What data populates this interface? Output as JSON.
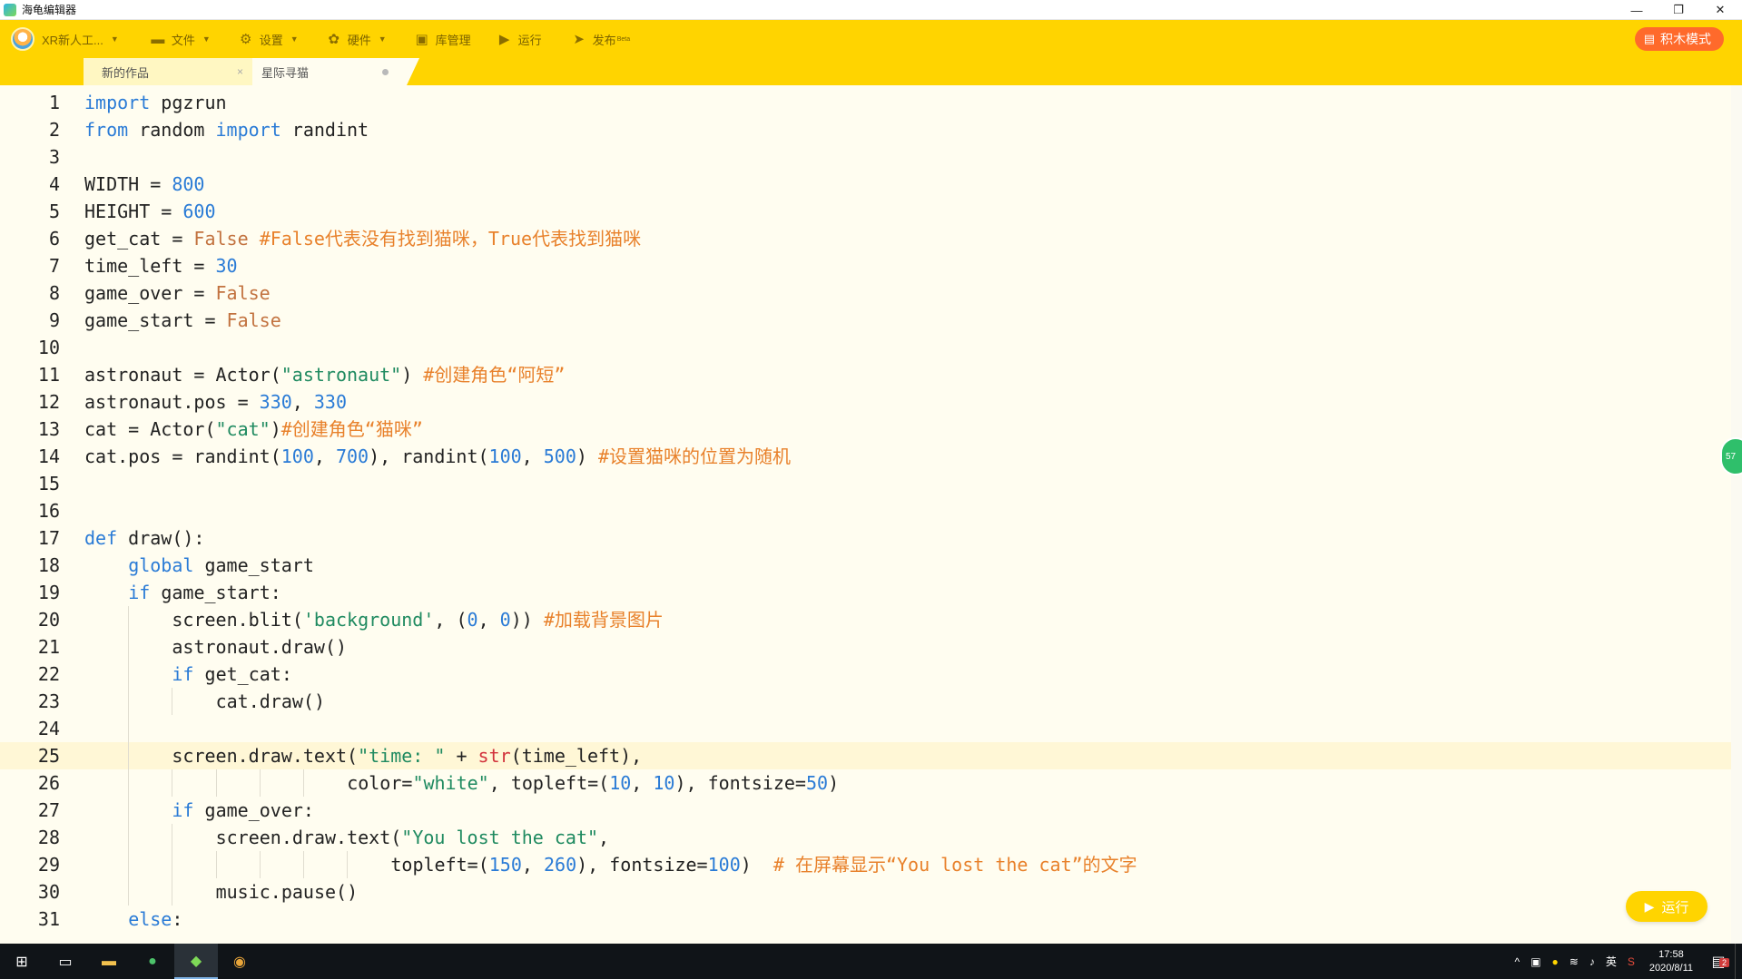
{
  "window": {
    "title": "海龟编辑器",
    "controls": {
      "minimize": "—",
      "restore": "❐",
      "close": "✕"
    }
  },
  "toolbar": {
    "user_label": "XR新人工...",
    "file_label": "文件",
    "settings_label": "设置",
    "hardware_label": "硬件",
    "library_label": "库管理",
    "run_label": "运行",
    "publish_label": "发布",
    "publish_badge": "Beta",
    "block_mode_label": "积木模式"
  },
  "tabs": [
    {
      "label": "新的作品",
      "close": "×"
    },
    {
      "label": "星际寻猫"
    }
  ],
  "editor": {
    "current_line": 25,
    "lines": [
      {
        "n": "1",
        "indent": 0,
        "tokens": [
          [
            "kw",
            "import"
          ],
          [
            "t",
            " pgzrun"
          ]
        ]
      },
      {
        "n": "2",
        "indent": 0,
        "tokens": [
          [
            "kw",
            "from"
          ],
          [
            "t",
            " random "
          ],
          [
            "kw",
            "import"
          ],
          [
            "t",
            " randint"
          ]
        ]
      },
      {
        "n": "3",
        "indent": 0,
        "tokens": []
      },
      {
        "n": "4",
        "indent": 0,
        "tokens": [
          [
            "t",
            "WIDTH = "
          ],
          [
            "num",
            "800"
          ]
        ]
      },
      {
        "n": "5",
        "indent": 0,
        "tokens": [
          [
            "t",
            "HEIGHT = "
          ],
          [
            "num",
            "600"
          ]
        ]
      },
      {
        "n": "6",
        "indent": 0,
        "tokens": [
          [
            "t",
            "get_cat = "
          ],
          [
            "bool",
            "False"
          ],
          [
            "t",
            " "
          ],
          [
            "cmt",
            "#False代表没有找到猫咪，True代表找到猫咪"
          ]
        ]
      },
      {
        "n": "7",
        "indent": 0,
        "tokens": [
          [
            "t",
            "time_left = "
          ],
          [
            "num",
            "30"
          ]
        ]
      },
      {
        "n": "8",
        "indent": 0,
        "tokens": [
          [
            "t",
            "game_over = "
          ],
          [
            "bool",
            "False"
          ]
        ]
      },
      {
        "n": "9",
        "indent": 0,
        "tokens": [
          [
            "t",
            "game_start = "
          ],
          [
            "bool",
            "False"
          ]
        ]
      },
      {
        "n": "10",
        "indent": 0,
        "tokens": []
      },
      {
        "n": "11",
        "indent": 0,
        "tokens": [
          [
            "t",
            "astronaut = Actor("
          ],
          [
            "str",
            "\"astronaut\""
          ],
          [
            "t",
            ") "
          ],
          [
            "cmt",
            "#创建角色“阿短”"
          ]
        ]
      },
      {
        "n": "12",
        "indent": 0,
        "tokens": [
          [
            "t",
            "astronaut.pos = "
          ],
          [
            "num",
            "330"
          ],
          [
            "t",
            ", "
          ],
          [
            "num",
            "330"
          ]
        ]
      },
      {
        "n": "13",
        "indent": 0,
        "tokens": [
          [
            "t",
            "cat = Actor("
          ],
          [
            "str",
            "\"cat\""
          ],
          [
            "t",
            ")"
          ],
          [
            "cmt",
            "#创建角色“猫咪”"
          ]
        ]
      },
      {
        "n": "14",
        "indent": 0,
        "tokens": [
          [
            "t",
            "cat.pos = randint("
          ],
          [
            "num",
            "100"
          ],
          [
            "t",
            ", "
          ],
          [
            "num",
            "700"
          ],
          [
            "t",
            "), randint("
          ],
          [
            "num",
            "100"
          ],
          [
            "t",
            ", "
          ],
          [
            "num",
            "500"
          ],
          [
            "t",
            ") "
          ],
          [
            "cmt",
            "#设置猫咪的位置为随机"
          ]
        ]
      },
      {
        "n": "15",
        "indent": 0,
        "tokens": []
      },
      {
        "n": "16",
        "indent": 0,
        "tokens": []
      },
      {
        "n": "17",
        "indent": 0,
        "tokens": [
          [
            "kw",
            "def"
          ],
          [
            "t",
            " draw():"
          ]
        ]
      },
      {
        "n": "18",
        "indent": 1,
        "tokens": [
          [
            "kw",
            "global"
          ],
          [
            "t",
            " game_start"
          ]
        ]
      },
      {
        "n": "19",
        "indent": 1,
        "tokens": [
          [
            "kw",
            "if"
          ],
          [
            "t",
            " game_start:"
          ]
        ]
      },
      {
        "n": "20",
        "indent": 2,
        "tokens": [
          [
            "t",
            "screen.blit("
          ],
          [
            "str",
            "'background'"
          ],
          [
            "t",
            ", ("
          ],
          [
            "num",
            "0"
          ],
          [
            "t",
            ", "
          ],
          [
            "num",
            "0"
          ],
          [
            "t",
            ")) "
          ],
          [
            "cmt",
            "#加载背景图片"
          ]
        ]
      },
      {
        "n": "21",
        "indent": 2,
        "tokens": [
          [
            "t",
            "astronaut.draw()"
          ]
        ]
      },
      {
        "n": "22",
        "indent": 2,
        "tokens": [
          [
            "kw",
            "if"
          ],
          [
            "t",
            " get_cat:"
          ]
        ]
      },
      {
        "n": "23",
        "indent": 3,
        "tokens": [
          [
            "t",
            "cat.draw()"
          ]
        ]
      },
      {
        "n": "24",
        "indent": 2,
        "tokens": []
      },
      {
        "n": "25",
        "indent": 2,
        "tokens": [
          [
            "t",
            "screen.draw.text("
          ],
          [
            "str",
            "\"time: \""
          ],
          [
            "t",
            " + "
          ],
          [
            "fn",
            "str"
          ],
          [
            "t",
            "(time_left),"
          ]
        ]
      },
      {
        "n": "26",
        "indent": 6,
        "tokens": [
          [
            "t",
            "color="
          ],
          [
            "str",
            "\"white\""
          ],
          [
            "t",
            ", topleft=("
          ],
          [
            "num",
            "10"
          ],
          [
            "t",
            ", "
          ],
          [
            "num",
            "10"
          ],
          [
            "t",
            "), fontsize="
          ],
          [
            "num",
            "50"
          ],
          [
            "t",
            ")"
          ]
        ]
      },
      {
        "n": "27",
        "indent": 2,
        "tokens": [
          [
            "kw",
            "if"
          ],
          [
            "t",
            " game_over:"
          ]
        ]
      },
      {
        "n": "28",
        "indent": 3,
        "tokens": [
          [
            "t",
            "screen.draw.text("
          ],
          [
            "str",
            "\"You lost the cat\""
          ],
          [
            "t",
            ","
          ]
        ]
      },
      {
        "n": "29",
        "indent": 7,
        "tokens": [
          [
            "t",
            "topleft=("
          ],
          [
            "num",
            "150"
          ],
          [
            "t",
            ", "
          ],
          [
            "num",
            "260"
          ],
          [
            "t",
            "), fontsize="
          ],
          [
            "num",
            "100"
          ],
          [
            "t",
            ")  "
          ],
          [
            "cmt",
            "# 在屏幕显示“You lost the cat”的文字"
          ]
        ]
      },
      {
        "n": "30",
        "indent": 3,
        "tokens": [
          [
            "t",
            "music.pause()"
          ]
        ]
      },
      {
        "n": "31",
        "indent": 1,
        "tokens": [
          [
            "kw",
            "else"
          ],
          [
            "t",
            ":"
          ]
        ]
      }
    ]
  },
  "side_bubble": "57",
  "run_fab_label": "运行",
  "taskbar": {
    "tray_lang": "英",
    "time": "17:58",
    "date": "2020/8/11",
    "notif_count": "2"
  }
}
